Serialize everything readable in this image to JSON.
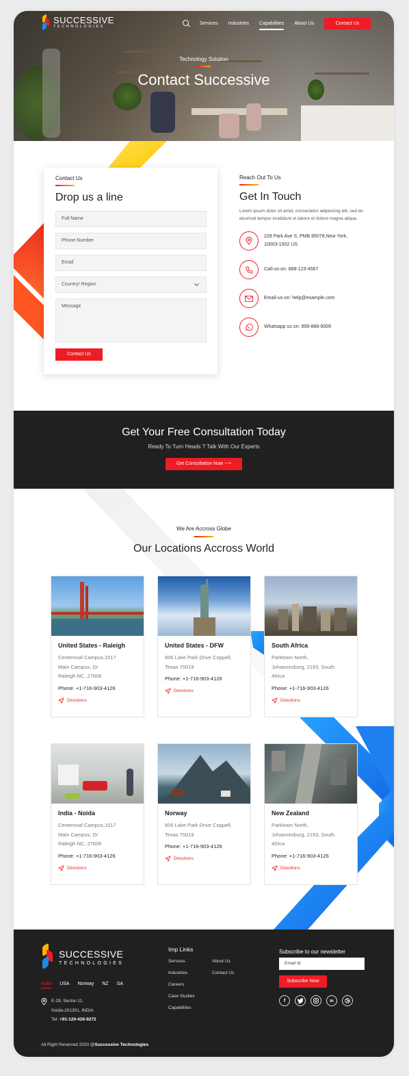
{
  "brand": {
    "name_line1": "SUCCESSIVE",
    "name_line2": "TECHNOLOGIES"
  },
  "nav": {
    "items": [
      "Services",
      "Industries",
      "Capabilities",
      "About Us"
    ],
    "cta": "Contact Us",
    "icon": "search-icon"
  },
  "hero": {
    "tagline": "Technology Solution",
    "title": "Contact Successive"
  },
  "form": {
    "kicker": "Contact Us",
    "title": "Drop us a line",
    "placeholders": {
      "full_name": "Full Name",
      "phone": "Phone Number",
      "email": "Email",
      "country": "Country/ Region",
      "message": "Message"
    },
    "submit": "Contact Us"
  },
  "reach": {
    "kicker": "Reach Out To Us",
    "title": "Get In Touch",
    "body": "Lorem ipsum dolor sit amet, consectetur adipisicing elit, sed do eiusmod tempor incididunt ut labore et dolore magna aliqua.",
    "items": [
      {
        "icon": "location-pin-icon",
        "line1": "228 Park Ave S, PMB 85078,New York,",
        "line2": "10003-1502 US"
      },
      {
        "icon": "phone-icon",
        "line1": "Call-us-on: 888-123-4567",
        "line2": ""
      },
      {
        "icon": "email-icon",
        "line1": "Email-us-on: help@example.com",
        "line2": ""
      },
      {
        "icon": "whatsapp-icon",
        "line1": "Whatsapp us on: 999-888-9009",
        "line2": ""
      }
    ]
  },
  "consult": {
    "title": "Get Your Free Consultation Today",
    "subtitle": "Ready To Turn Heads ? Talk With Our Experts",
    "button": "Get Consultation Now"
  },
  "locations": {
    "kicker": "We Are Accross Globe",
    "title": "Our Locations Accross World",
    "directions_label": "Directions",
    "cards": [
      {
        "name": "United States - Raleigh",
        "a1": "Centennial Campus,1017",
        "a2": "Main Campus, Dr",
        "a3": "Raleigh NC, 27606",
        "phone": "Phone: +1-716-903-4126"
      },
      {
        "name": "United States - DFW",
        "a1": "606 Lake Park Drive Coppell,",
        "a2": "Texas 75019",
        "a3": "",
        "phone": "Phone: +1-716-903-4126"
      },
      {
        "name": "South Africa",
        "a1": "Parktown North,",
        "a2": "Johannesburg, 2193, South",
        "a3": "Africa",
        "phone": "Phone: +1-716-903-4126"
      },
      {
        "name": "India - Noida",
        "a1": "Centennial Campus,1017",
        "a2": "Main Campus, Dr",
        "a3": "Raleigh NC, 27606",
        "phone": "Phone: +1-716-903-4126"
      },
      {
        "name": "Norway",
        "a1": "606 Lake Park Drive Coppell,",
        "a2": "Texas 75019",
        "a3": "",
        "phone": "Phone: +1-716-903-4126"
      },
      {
        "name": "New Zealand",
        "a1": "Parktown North,",
        "a2": "Johannesburg, 2193, South",
        "a3": "Africa",
        "phone": "Phone: +1-716-903-4126"
      }
    ]
  },
  "footer": {
    "countries": [
      "India",
      "USA",
      "Norway",
      "NZ",
      "SA"
    ],
    "address": {
      "line1": "E-29, Sector-11,",
      "line2": "Noida-201301, INDIA",
      "tel_label": "Tel:",
      "tel": "+91-120-426-9272"
    },
    "links_title": "Imp Links",
    "links_col1": [
      "Services",
      "Industries",
      "Careers",
      "Case Studies",
      "Capabilities"
    ],
    "links_col2": [
      "About Us",
      "Contact Us"
    ],
    "newsletter_title": "Subscribe to our newsletter",
    "email_placeholder": "Email Id",
    "subscribe": "Subscribe Now",
    "socials": [
      "facebook-icon",
      "twitter-icon",
      "instagram-icon",
      "linkedin-icon",
      "dribbble-icon"
    ],
    "copyright_prefix": "All Right Reserved 2020 @",
    "copyright_name": "Successive Technologies"
  },
  "colors": {
    "accent": "#ee1c25",
    "dark": "#202020",
    "gradient_start": "#ee1c25",
    "gradient_end": "#ffb400",
    "blue": "#1e88e5"
  }
}
